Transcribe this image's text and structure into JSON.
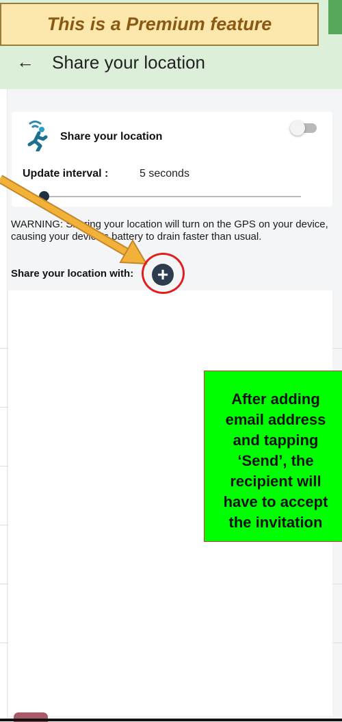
{
  "banner": {
    "text": "This is a Premium feature"
  },
  "header": {
    "back_icon": "←",
    "title": "Share your location"
  },
  "card": {
    "title": "Share your location",
    "toggle_on": false,
    "interval_label": "Update interval :",
    "interval_value": "5 seconds",
    "slider_fraction": 0.0
  },
  "warning": "WARNING: Sharing your location will turn on the GPS on your device, causing your device's battery to drain faster than usual.",
  "share_with": {
    "label": "Share your location with:",
    "add_icon": "+"
  },
  "callout": {
    "lines": [
      "After adding",
      "email address",
      "and tapping",
      "‘Send’, the",
      "recipient will",
      "have to accept",
      "the invitation"
    ]
  },
  "colors": {
    "accent": "#2d3d4e",
    "header_bg": "#dcefd9",
    "callout_bg": "#00ff00",
    "highlight": "#e41c1c"
  }
}
